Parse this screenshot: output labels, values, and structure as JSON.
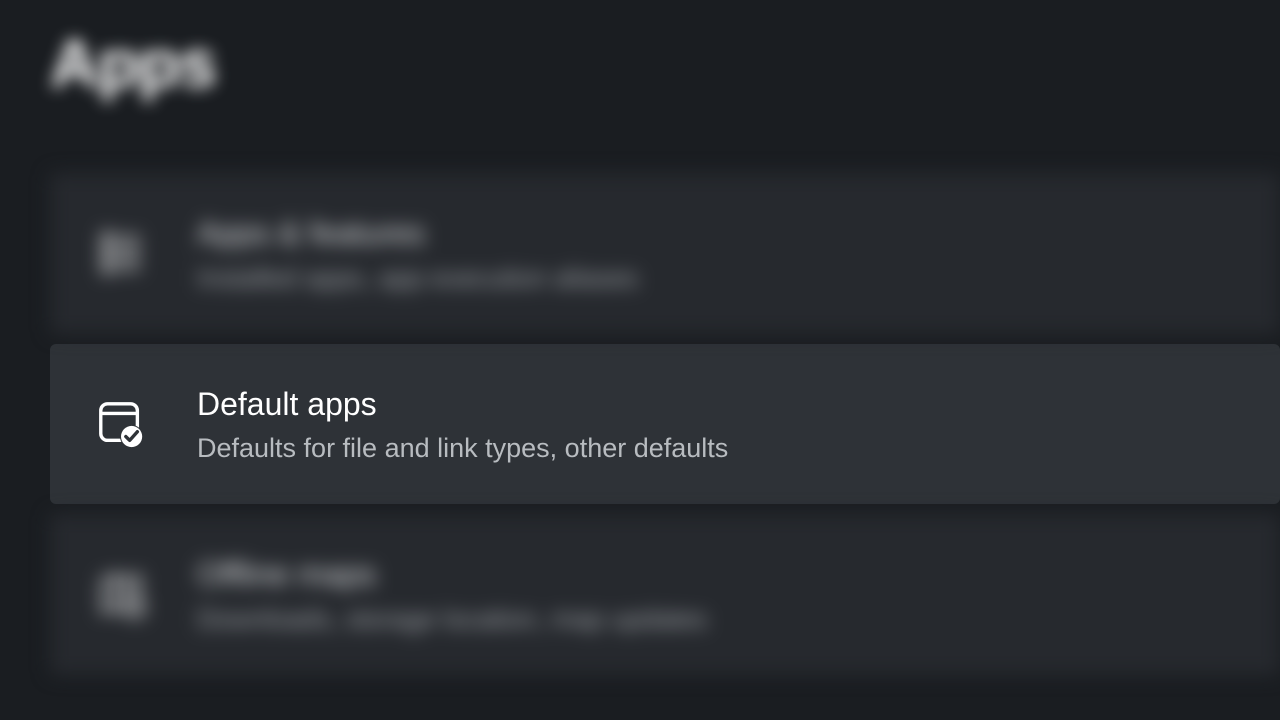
{
  "page": {
    "title": "Apps"
  },
  "items": [
    {
      "title": "Apps & features",
      "subtitle": "Installed apps, app execution aliases",
      "icon": "apps-list",
      "focused": false,
      "blurred": true
    },
    {
      "title": "Default apps",
      "subtitle": "Defaults for file and link types, other defaults",
      "icon": "default-apps",
      "focused": true,
      "blurred": false
    },
    {
      "title": "Offline maps",
      "subtitle": "Downloads, storage location, map updates",
      "icon": "offline-maps",
      "focused": false,
      "blurred": true
    }
  ]
}
